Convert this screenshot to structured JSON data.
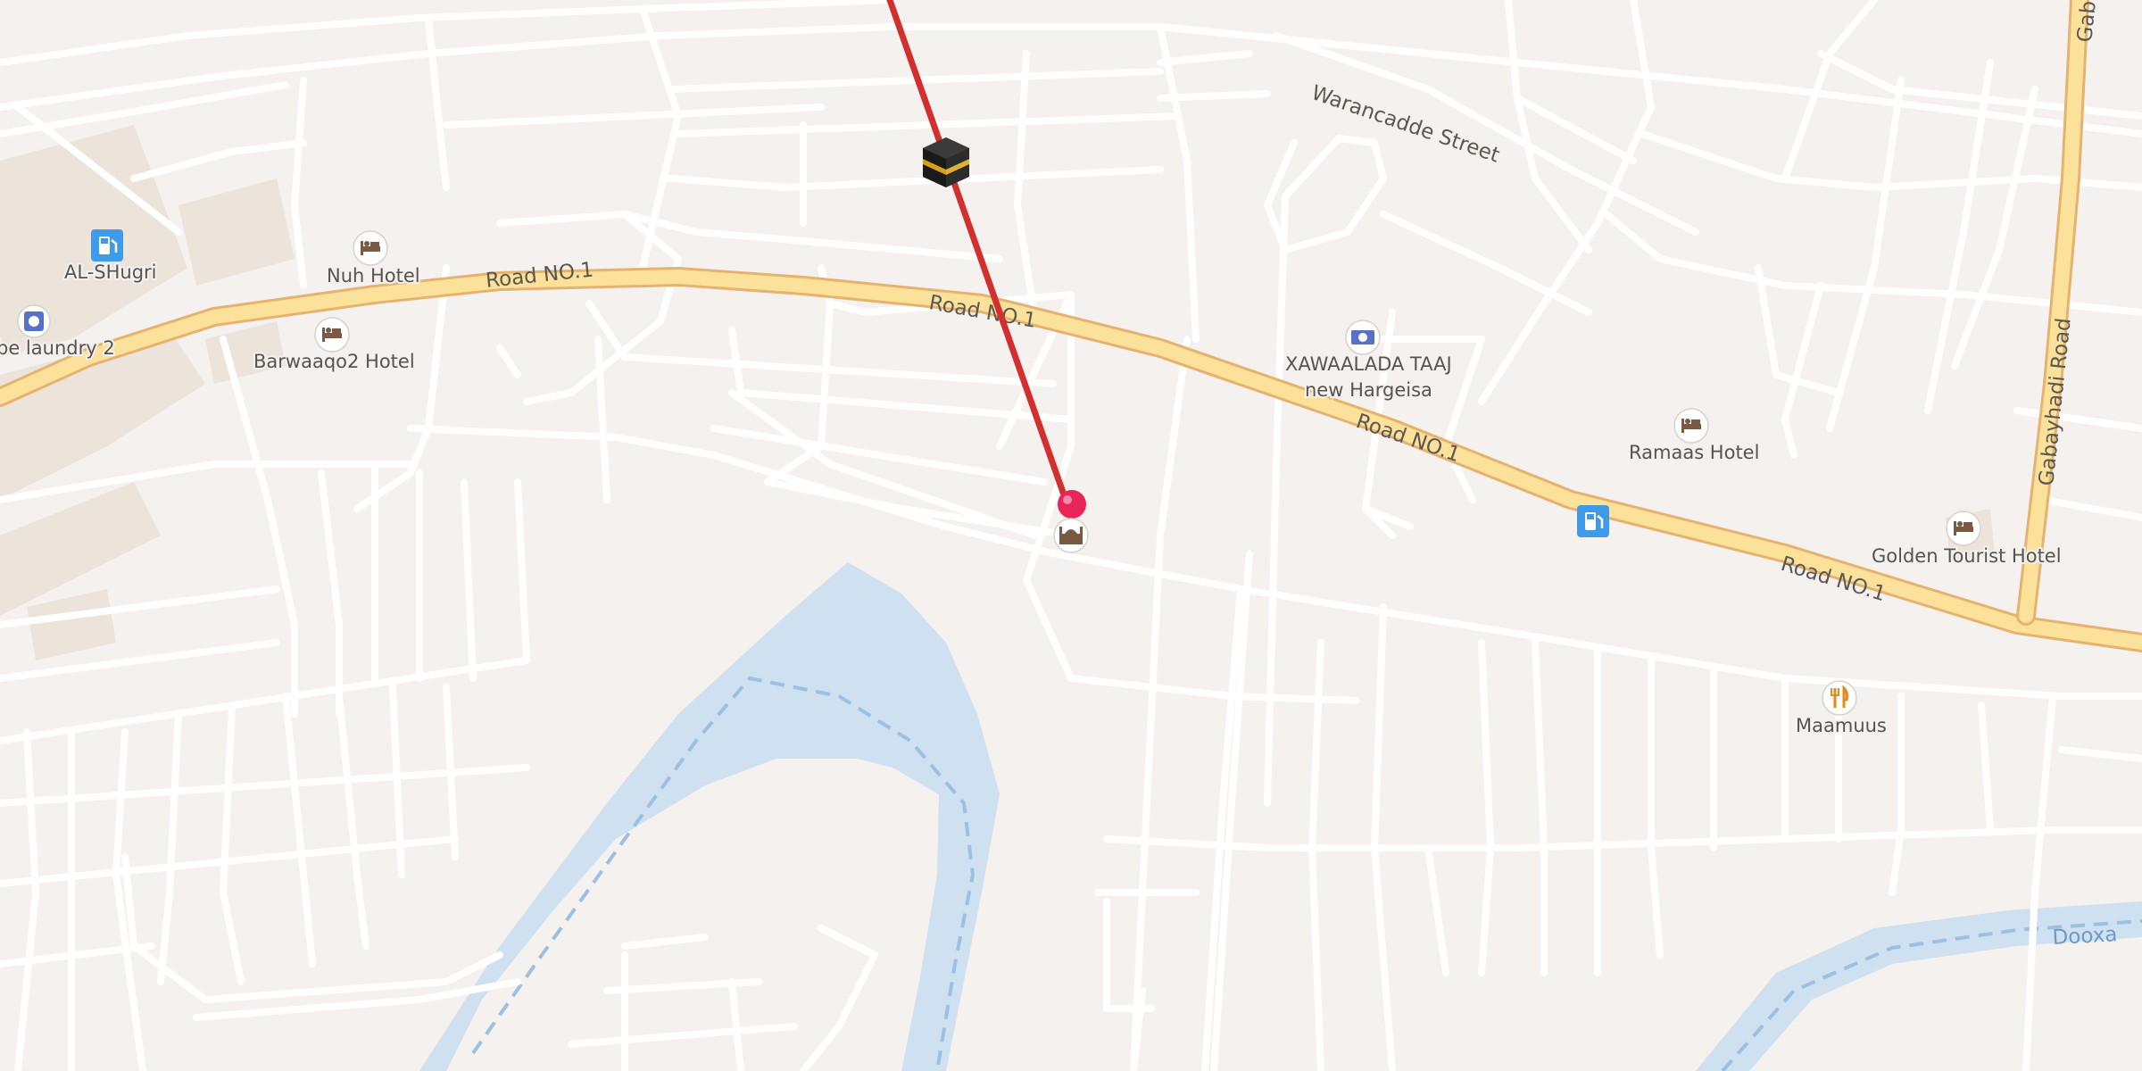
{
  "map": {
    "road_labels": {
      "road_no1_a": "Road NO.1",
      "road_no1_b": "Road NO.1",
      "road_no1_c": "Road NO.1",
      "road_no1_d": "Road NO.1",
      "warancadde": "Warancadde Street",
      "gabayhadi": "Gabayhadi Road",
      "gabayhadi_top": "Gab"
    },
    "water_labels": {
      "dooxa": "Dooxa"
    },
    "pois": [
      {
        "id": "al-shugri",
        "label": "AL-SHugri",
        "icon": "fuel-station-icon",
        "color": "#3d9be9"
      },
      {
        "id": "laundry",
        "label": "be laundry 2",
        "icon": "laundry-icon",
        "color": "#5a6fc8"
      },
      {
        "id": "nuh-hotel",
        "label": "Nuh Hotel",
        "icon": "hotel-icon"
      },
      {
        "id": "barwaaqo2",
        "label": "Barwaaqo2 Hotel",
        "icon": "hotel-icon"
      },
      {
        "id": "xawaalada",
        "label": "XAWAALADA TAAJ",
        "label2": "new Hargeisa",
        "icon": "money-exchange-icon",
        "color": "#5a6fc8"
      },
      {
        "id": "ramaas",
        "label": "Ramaas Hotel",
        "icon": "hotel-icon"
      },
      {
        "id": "golden-tourist",
        "label": "Golden Tourist Hotel",
        "icon": "hotel-icon"
      },
      {
        "id": "maamuus",
        "label": "Maamuus",
        "icon": "restaurant-icon",
        "color": "#e38a1a"
      },
      {
        "id": "fuel-2",
        "label": "",
        "icon": "fuel-station-icon",
        "color": "#3d9be9"
      },
      {
        "id": "mosque",
        "label": "",
        "icon": "mosque-icon"
      }
    ],
    "qibla": {
      "line_color": "#d32f2f",
      "kaaba_icon": "kaaba-icon",
      "pin_icon": "location-pin-icon",
      "pin_color": "#e8255b"
    },
    "colors": {
      "background": "#f4f1ee",
      "water": "#cfe0f1",
      "main_road": "#fbe19a",
      "minor_road": "#ffffff",
      "built_area": "#ece3da"
    }
  }
}
